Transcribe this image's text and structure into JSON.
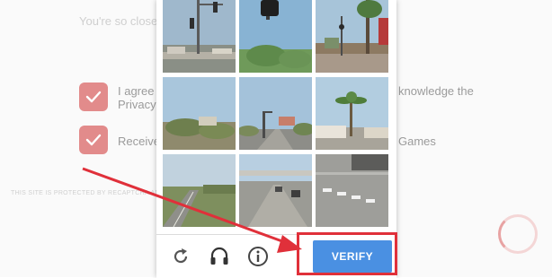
{
  "background": {
    "heading_partial": "You're so close",
    "consent_line1": "I agree",
    "consent_line1_right": "knowledge the",
    "consent_line1_sub": "Privacy",
    "consent_line2": "Receive",
    "consent_line2_right": "Games",
    "recaptcha_note": "THIS SITE IS PROTECTED BY RECAPTCHA AND"
  },
  "captcha": {
    "verify_label": "VERIFY",
    "icons": {
      "reload": "reload-icon",
      "audio": "headphones-icon",
      "info": "info-icon"
    }
  },
  "colors": {
    "checkbox": "#e28b8b",
    "verify_button": "#4a90e2",
    "highlight": "#e0303a",
    "spinner": "#e8a3a3"
  }
}
